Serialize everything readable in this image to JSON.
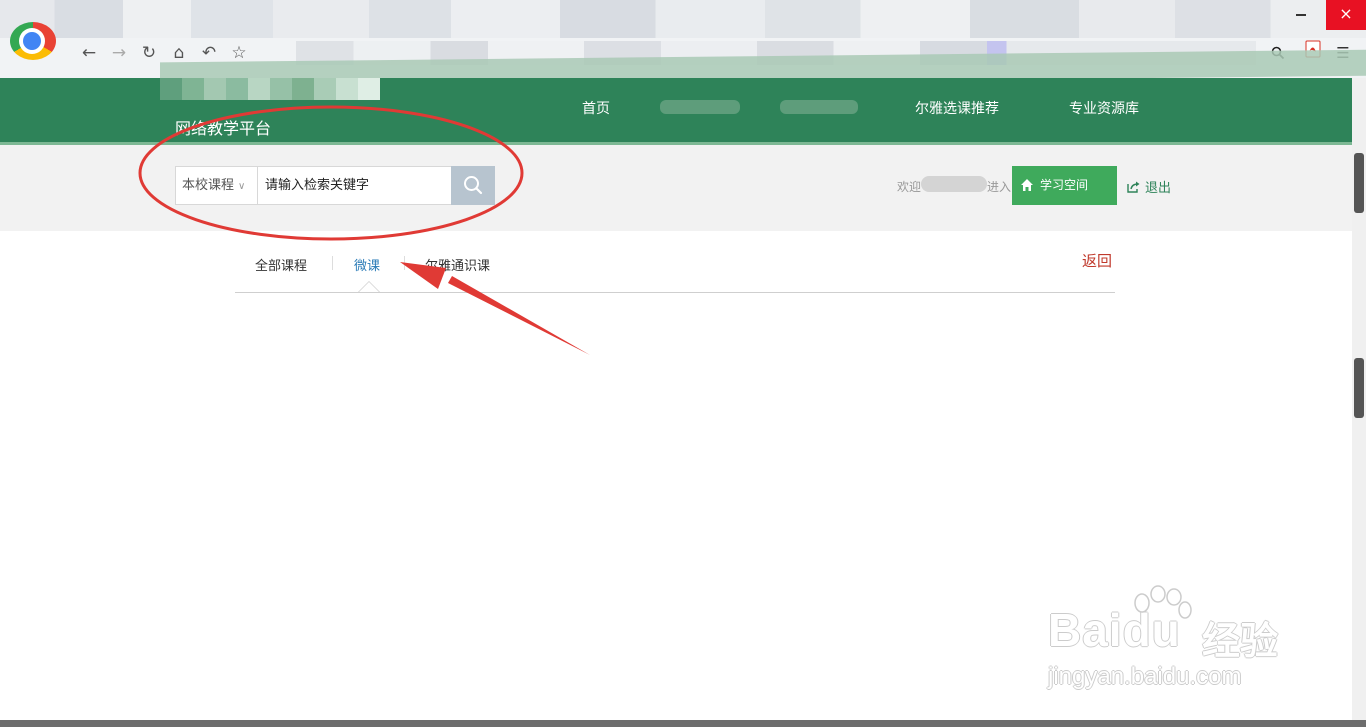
{
  "browser": {
    "nav_icons": [
      "back-icon",
      "forward-icon",
      "reload-icon",
      "home-icon",
      "undo-icon",
      "star-icon"
    ],
    "right_icons": [
      "search-icon",
      "pdf-icon",
      "menu-icon"
    ],
    "close_glyph": "×"
  },
  "site": {
    "platform_name": "网络教学平台",
    "nav": {
      "home": "首页",
      "elite_recommend": "尔雅选课推荐",
      "resource_library": "专业资源库"
    },
    "brand_color": "#2e8359"
  },
  "search": {
    "scope_selected": "本校课程",
    "input_value": "请输入检索关键字"
  },
  "user_area": {
    "welcome_prefix": "欢迎",
    "welcome_suffix": "进入",
    "study_space": "学习空间",
    "logout": "退出"
  },
  "tabs": {
    "all": "全部课程",
    "micro": "微课",
    "erya": "尔雅通识课",
    "active": "微课",
    "back": "返回"
  },
  "watermark": {
    "main": "Baidu",
    "chinese": "经验",
    "url": "jingyan.baidu.com"
  },
  "colors": {
    "annotation_red": "#e03a35",
    "active_tab": "#2a7bb7",
    "study_button": "#3faa5c",
    "search_button": "#b7c4cf",
    "back_link": "#c0392b"
  }
}
